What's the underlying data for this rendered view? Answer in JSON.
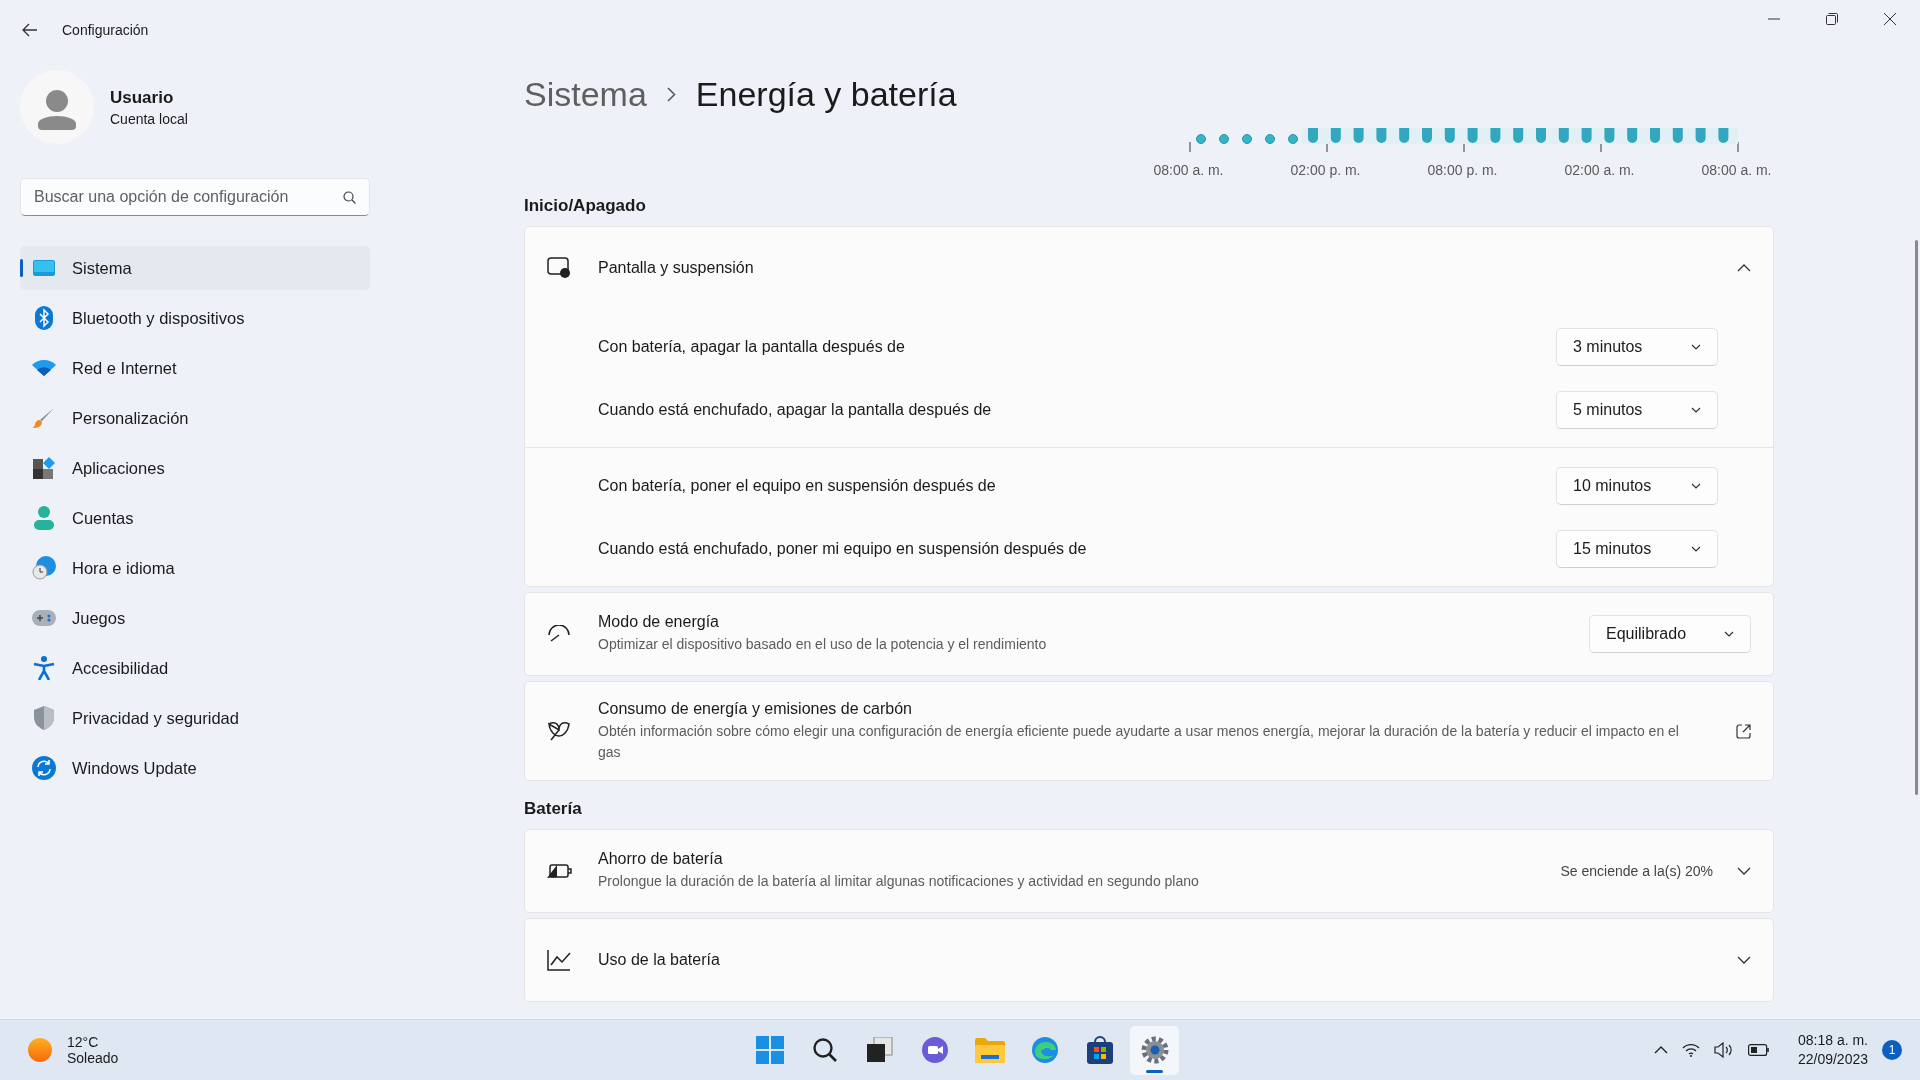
{
  "window": {
    "title": "Configuración"
  },
  "user": {
    "name": "Usuario",
    "account": "Cuenta local"
  },
  "search": {
    "placeholder": "Buscar una opción de configuración"
  },
  "sidebar": {
    "items": [
      {
        "label": "Sistema",
        "selected": true
      },
      {
        "label": "Bluetooth y dispositivos",
        "selected": false
      },
      {
        "label": "Red e Internet",
        "selected": false
      },
      {
        "label": "Personalización",
        "selected": false
      },
      {
        "label": "Aplicaciones",
        "selected": false
      },
      {
        "label": "Cuentas",
        "selected": false
      },
      {
        "label": "Hora e idioma",
        "selected": false
      },
      {
        "label": "Juegos",
        "selected": false
      },
      {
        "label": "Accesibilidad",
        "selected": false
      },
      {
        "label": "Privacidad y seguridad",
        "selected": false
      },
      {
        "label": "Windows Update",
        "selected": false
      }
    ]
  },
  "breadcrumb": {
    "parent": "Sistema",
    "current": "Energía y batería"
  },
  "battery_chart": {
    "time_labels": [
      "08:00 a. m.",
      "02:00 p. m.",
      "08:00 p. m.",
      "02:00 a. m.",
      "08:00 a. m."
    ]
  },
  "sections": [
    {
      "heading": "Inicio/Apagado",
      "cards": [
        {
          "kind": "expander",
          "title": "Pantalla y suspensión",
          "expanded": true,
          "groups": [
            {
              "rows": [
                {
                  "label": "Con batería, apagar la pantalla después de",
                  "value": "3 minutos"
                },
                {
                  "label": "Cuando está enchufado, apagar la pantalla después de",
                  "value": "5 minutos"
                }
              ]
            },
            {
              "rows": [
                {
                  "label": "Con batería, poner el equipo en suspensión después de",
                  "value": "10 minutos"
                },
                {
                  "label": "Cuando está enchufado, poner mi equipo en suspensión después de",
                  "value": "15 minutos"
                }
              ]
            }
          ]
        },
        {
          "kind": "dropdown",
          "title": "Modo de energía",
          "description": "Optimizar el dispositivo basado en el uso de la potencia y el rendimiento",
          "value": "Equilibrado"
        },
        {
          "kind": "link",
          "title": "Consumo de energía y emisiones de carbón",
          "description": "Obtén información sobre cómo elegir una configuración de energía eficiente puede ayudarte a usar menos energía, mejorar la duración de la batería y reducir el impacto en el gas"
        }
      ]
    },
    {
      "heading": "Batería",
      "cards": [
        {
          "kind": "expander",
          "title": "Ahorro de batería",
          "description": "Prolongue la duración de la batería al limitar algunas notificaciones y actividad en segundo plano",
          "status": "Se enciende a la(s) 20%",
          "expanded": false
        },
        {
          "kind": "expander",
          "title": "Uso de la batería",
          "expanded": false
        }
      ]
    }
  ],
  "taskbar": {
    "weather": {
      "temperature": "12°C",
      "condition": "Soleado"
    },
    "apps": [
      {
        "active": false
      },
      {
        "active": false
      },
      {
        "active": false
      },
      {
        "active": false
      },
      {
        "active": false
      },
      {
        "active": false
      },
      {
        "active": false
      },
      {
        "active": true
      }
    ],
    "clock": {
      "time": "08:18 a. m.",
      "date": "22/09/2023"
    },
    "notification_count": "1"
  }
}
